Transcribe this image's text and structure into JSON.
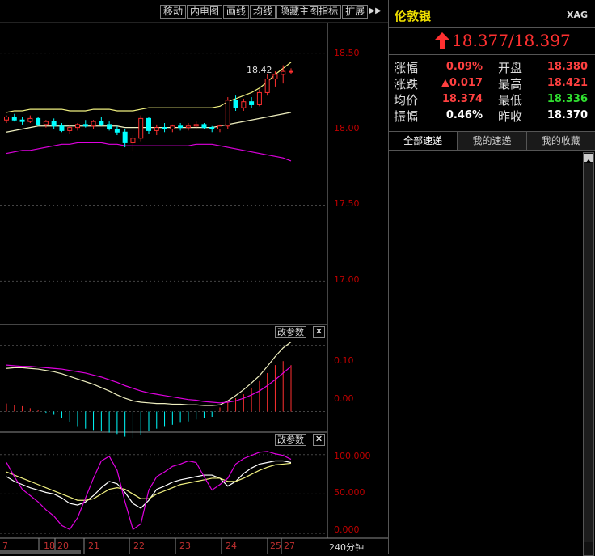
{
  "toolbar": {
    "items": [
      "移动",
      "内电图",
      "画线",
      "均线",
      "隐藏主图指标",
      "扩展"
    ]
  },
  "chart": {
    "price_axis": [
      "18.50",
      "18.00",
      "17.50",
      "17.00"
    ],
    "macd_axis": [
      "0.10",
      "0.00"
    ],
    "kdj_axis": [
      "100.000",
      "50.000",
      "0.000"
    ],
    "dates": [
      "7",
      "18",
      "20",
      "21",
      "22",
      "23",
      "24",
      "25",
      "27"
    ],
    "period": "240分钟",
    "param_label": "改参数",
    "close_label": "✕",
    "high_annotation": "18.42"
  },
  "chart_data": {
    "type": "candlestick",
    "colors": {
      "up": "#ff3030",
      "down": "#00ffff",
      "upper_band": "#f0f080",
      "mid_band": "#f0f0c0",
      "lower_band": "#e000e0"
    },
    "candles": [
      [
        18.06,
        18.09,
        18.04,
        18.08
      ],
      [
        18.08,
        18.1,
        18.05,
        18.06
      ],
      [
        18.06,
        18.08,
        18.03,
        18.05
      ],
      [
        18.05,
        18.09,
        18.04,
        18.07
      ],
      [
        18.07,
        18.08,
        18.02,
        18.03
      ],
      [
        18.03,
        18.06,
        18.01,
        18.05
      ],
      [
        18.05,
        18.07,
        18.0,
        18.02
      ],
      [
        18.02,
        18.04,
        17.98,
        17.99
      ],
      [
        17.99,
        18.03,
        17.97,
        18.01
      ],
      [
        18.01,
        18.04,
        17.99,
        18.03
      ],
      [
        18.03,
        18.06,
        18.01,
        18.02
      ],
      [
        18.02,
        18.06,
        18.0,
        18.05
      ],
      [
        18.05,
        18.08,
        18.02,
        18.03
      ],
      [
        18.03,
        18.05,
        17.99,
        18.0
      ],
      [
        18.0,
        18.02,
        17.96,
        17.98
      ],
      [
        17.98,
        18.0,
        17.88,
        17.91
      ],
      [
        17.91,
        17.96,
        17.86,
        17.94
      ],
      [
        17.94,
        18.09,
        17.92,
        18.07
      ],
      [
        18.07,
        18.08,
        17.97,
        17.99
      ],
      [
        17.99,
        18.03,
        17.96,
        18.01
      ],
      [
        18.01,
        18.04,
        17.98,
        18.0
      ],
      [
        18.0,
        18.03,
        17.98,
        18.02
      ],
      [
        18.02,
        18.04,
        17.99,
        18.01
      ],
      [
        18.01,
        18.04,
        17.99,
        18.02
      ],
      [
        18.02,
        18.05,
        18.0,
        18.03
      ],
      [
        18.03,
        18.04,
        18.0,
        18.01
      ],
      [
        18.01,
        18.02,
        17.98,
        18.0
      ],
      [
        18.0,
        18.03,
        17.98,
        18.02
      ],
      [
        18.02,
        18.21,
        18.0,
        18.19
      ],
      [
        18.19,
        18.22,
        18.12,
        18.14
      ],
      [
        18.14,
        18.2,
        18.12,
        18.18
      ],
      [
        18.18,
        18.21,
        18.14,
        18.16
      ],
      [
        18.16,
        18.26,
        18.15,
        18.24
      ],
      [
        18.24,
        18.36,
        18.22,
        18.33
      ],
      [
        18.33,
        18.38,
        18.28,
        18.36
      ],
      [
        18.36,
        18.42,
        18.3,
        18.38
      ],
      [
        18.38,
        18.4,
        18.36,
        18.38
      ]
    ],
    "upper_band": [
      18.11,
      18.12,
      18.12,
      18.13,
      18.13,
      18.13,
      18.13,
      18.13,
      18.12,
      18.12,
      18.12,
      18.13,
      18.13,
      18.13,
      18.12,
      18.12,
      18.12,
      18.13,
      18.14,
      18.14,
      18.14,
      18.14,
      18.14,
      18.14,
      18.14,
      18.14,
      18.14,
      18.15,
      18.18,
      18.2,
      18.22,
      18.24,
      18.27,
      18.31,
      18.36,
      18.4,
      18.44
    ],
    "mid_band": [
      17.98,
      17.99,
      18.0,
      18.01,
      18.02,
      18.02,
      18.02,
      18.02,
      18.02,
      18.02,
      18.02,
      18.02,
      18.02,
      18.02,
      18.02,
      18.01,
      18.01,
      18.01,
      18.01,
      18.01,
      18.01,
      18.01,
      18.01,
      18.01,
      18.01,
      18.01,
      18.01,
      18.02,
      18.03,
      18.04,
      18.05,
      18.06,
      18.07,
      18.08,
      18.09,
      18.1,
      18.11
    ],
    "lower_band": [
      17.84,
      17.85,
      17.86,
      17.86,
      17.87,
      17.88,
      17.89,
      17.9,
      17.9,
      17.91,
      17.91,
      17.91,
      17.91,
      17.9,
      17.9,
      17.89,
      17.89,
      17.89,
      17.89,
      17.89,
      17.89,
      17.89,
      17.89,
      17.89,
      17.9,
      17.9,
      17.9,
      17.89,
      17.88,
      17.87,
      17.86,
      17.85,
      17.84,
      17.83,
      17.82,
      17.81,
      17.79
    ],
    "price_range": [
      16.72,
      18.7
    ],
    "macd": {
      "range": [
        -0.03,
        0.13
      ],
      "diff": [
        0.065,
        0.066,
        0.066,
        0.065,
        0.064,
        0.062,
        0.06,
        0.057,
        0.053,
        0.049,
        0.045,
        0.041,
        0.036,
        0.031,
        0.025,
        0.02,
        0.016,
        0.014,
        0.013,
        0.012,
        0.012,
        0.011,
        0.011,
        0.01,
        0.01,
        0.009,
        0.009,
        0.01,
        0.016,
        0.024,
        0.033,
        0.043,
        0.054,
        0.068,
        0.083,
        0.096,
        0.105
      ],
      "dea": [
        0.07,
        0.069,
        0.068,
        0.068,
        0.067,
        0.066,
        0.065,
        0.064,
        0.062,
        0.06,
        0.058,
        0.055,
        0.052,
        0.048,
        0.044,
        0.039,
        0.035,
        0.031,
        0.028,
        0.026,
        0.024,
        0.022,
        0.02,
        0.018,
        0.017,
        0.015,
        0.014,
        0.013,
        0.014,
        0.016,
        0.02,
        0.025,
        0.031,
        0.039,
        0.048,
        0.058,
        0.068
      ],
      "hist": [
        0.012,
        0.01,
        0.008,
        0.005,
        0.003,
        -0.002,
        -0.005,
        -0.01,
        -0.016,
        -0.022,
        -0.026,
        -0.028,
        -0.03,
        -0.032,
        -0.034,
        -0.038,
        -0.04,
        -0.035,
        -0.03,
        -0.026,
        -0.022,
        -0.02,
        -0.017,
        -0.015,
        -0.012,
        -0.01,
        -0.008,
        0.006,
        0.015,
        0.02,
        0.026,
        0.036,
        0.046,
        0.058,
        0.07,
        0.076,
        0.07
      ]
    },
    "kdj": {
      "range": [
        -5,
        110
      ],
      "k": [
        72,
        66,
        62,
        58,
        55,
        52,
        50,
        45,
        38,
        36,
        40,
        48,
        58,
        66,
        63,
        52,
        38,
        32,
        42,
        56,
        60,
        65,
        68,
        70,
        72,
        74,
        74,
        70,
        60,
        66,
        76,
        83,
        88,
        90,
        92,
        92,
        90
      ],
      "d": [
        78,
        74,
        70,
        66,
        62,
        58,
        54,
        50,
        46,
        42,
        42,
        44,
        50,
        56,
        58,
        56,
        50,
        44,
        44,
        50,
        54,
        58,
        62,
        64,
        66,
        68,
        70,
        70,
        66,
        66,
        70,
        75,
        80,
        84,
        87,
        88,
        89
      ],
      "j": [
        90,
        72,
        56,
        48,
        40,
        30,
        22,
        10,
        5,
        20,
        45,
        70,
        92,
        98,
        80,
        40,
        5,
        12,
        55,
        72,
        78,
        85,
        88,
        92,
        90,
        72,
        55,
        62,
        70,
        88,
        95,
        99,
        103,
        104,
        101,
        99,
        94
      ]
    }
  },
  "quote": {
    "title": "伦敦银",
    "code": "XAG",
    "price": "18.377/18.397",
    "stats": [
      [
        {
          "label": "涨幅",
          "value": "0.09%",
          "color": "#ff4040"
        },
        {
          "label": "开盘",
          "value": "18.380",
          "color": "#ff4040"
        }
      ],
      [
        {
          "label": "涨跌",
          "value": "▲0.017",
          "color": "#ff4040"
        },
        {
          "label": "最高",
          "value": "18.421",
          "color": "#ff4040"
        }
      ],
      [
        {
          "label": "均价",
          "value": "18.374",
          "color": "#ff4040"
        },
        {
          "label": "最低",
          "value": "18.336",
          "color": "#30e030"
        }
      ],
      [
        {
          "label": "振幅",
          "value": "0.46%",
          "color": "#ffffff"
        },
        {
          "label": "昨收",
          "value": "18.370",
          "color": "#ffffff"
        }
      ]
    ],
    "tabs": [
      "全部速递",
      "我的速递",
      "我的收藏"
    ]
  }
}
